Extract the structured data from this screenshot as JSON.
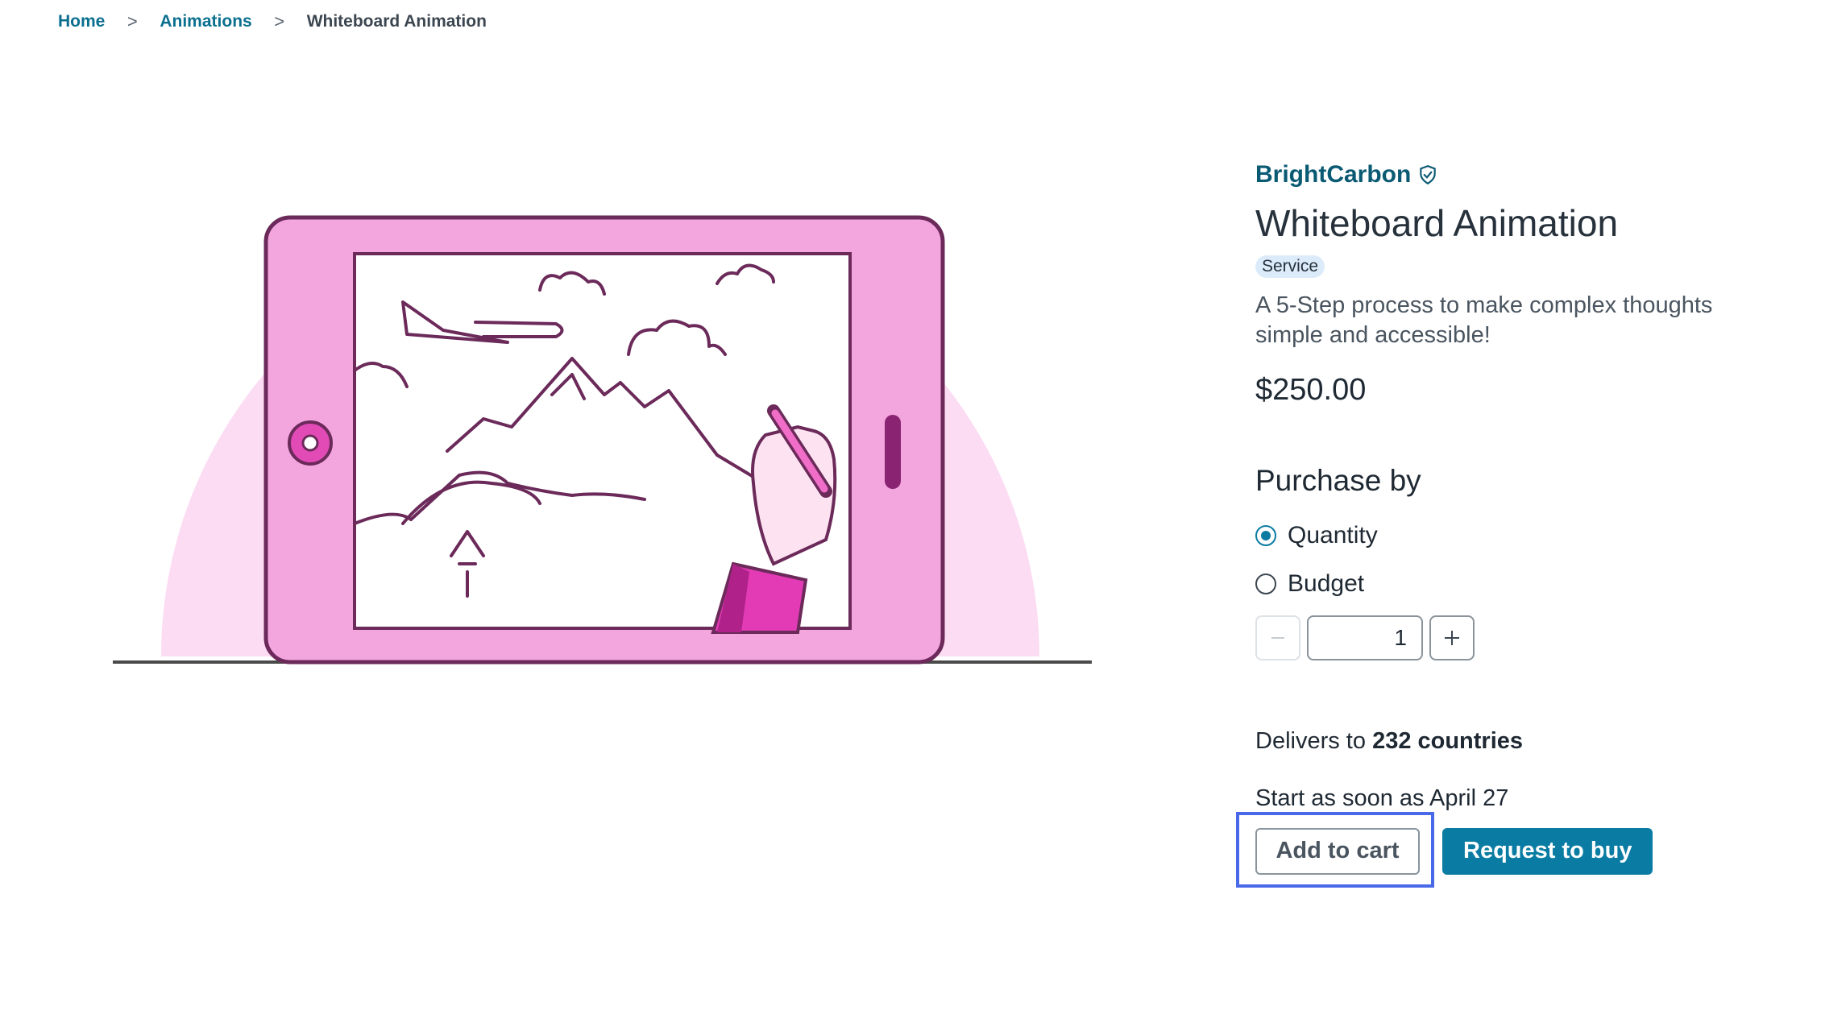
{
  "breadcrumb": {
    "home": "Home",
    "category": "Animations",
    "current": "Whiteboard Animation",
    "separator": ">"
  },
  "product": {
    "vendor": "BrightCarbon",
    "vendor_icon": "verified-shield-icon",
    "title": "Whiteboard Animation",
    "tag": "Service",
    "description": "A 5-Step process to make complex thoughts simple and accessible!",
    "price": "$250.00"
  },
  "purchase": {
    "heading": "Purchase by",
    "options": [
      {
        "label": "Quantity",
        "selected": true
      },
      {
        "label": "Budget",
        "selected": false
      }
    ],
    "quantity": "1",
    "decrement_icon": "minus-icon",
    "increment_icon": "plus-icon"
  },
  "delivery": {
    "prefix": "Delivers to",
    "count": "232 countries",
    "start": "Start as soon as April 27"
  },
  "actions": {
    "add_to_cart": "Add to cart",
    "request_to_buy": "Request to buy"
  },
  "colors": {
    "accent": "#0a7ca3",
    "link": "#0a6f8f",
    "focus": "#4a69e8",
    "illustration_pink": "#f3a6de"
  }
}
